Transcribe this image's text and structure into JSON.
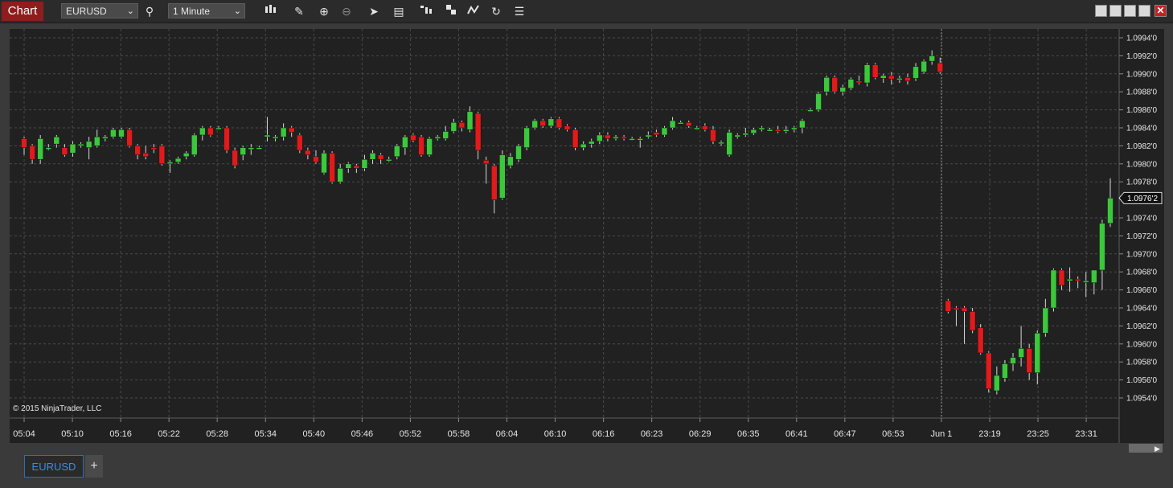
{
  "toolbar": {
    "chart_tab": "Chart",
    "instrument": "EURUSD",
    "interval": "1 Minute"
  },
  "chart": {
    "copyright": "© 2015 NinjaTrader, LLC",
    "price_labels": [
      "1.0994'0",
      "1.0992'0",
      "1.0990'0",
      "1.0988'0",
      "1.0986'0",
      "1.0984'0",
      "1.0982'0",
      "1.0980'0",
      "1.0978'0",
      "1.0976'2",
      "1.0974'0",
      "1.0972'0",
      "1.0970'0",
      "1.0968'0",
      "1.0966'0",
      "1.0964'0",
      "1.0962'0",
      "1.0960'0",
      "1.0958'0",
      "1.0956'0",
      "1.0954'0"
    ],
    "time_labels": [
      "05:04",
      "05:10",
      "05:16",
      "05:22",
      "05:28",
      "05:34",
      "05:40",
      "05:46",
      "05:52",
      "05:58",
      "06:04",
      "06:10",
      "06:16",
      "06:23",
      "06:29",
      "06:35",
      "06:41",
      "06:47",
      "06:53",
      "Jun 1",
      "23:19",
      "23:25",
      "23:31"
    ],
    "current_price": "1.0976'2",
    "colors": {
      "up": "#3cc83c",
      "down": "#e01b1b",
      "background": "#212121",
      "grid": "#4a4a4a"
    }
  },
  "chart_data": {
    "type": "candlestick",
    "instrument": "EURUSD",
    "interval": "1 Minute",
    "ylim": [
      1.0953,
      1.0995
    ],
    "candles": [
      {
        "o": 1.09828,
        "h": 1.0983,
        "l": 1.0981,
        "c": 1.09818
      },
      {
        "o": 1.0982,
        "h": 1.09822,
        "l": 1.098,
        "c": 1.09805
      },
      {
        "o": 1.09805,
        "h": 1.09832,
        "l": 1.098,
        "c": 1.09828
      },
      {
        "o": 1.09818,
        "h": 1.09822,
        "l": 1.09815,
        "c": 1.09818
      },
      {
        "o": 1.09822,
        "h": 1.09832,
        "l": 1.09818,
        "c": 1.0983
      },
      {
        "o": 1.09818,
        "h": 1.09822,
        "l": 1.09808,
        "c": 1.0981
      },
      {
        "o": 1.09812,
        "h": 1.09825,
        "l": 1.09808,
        "c": 1.09822
      },
      {
        "o": 1.09822,
        "h": 1.09824,
        "l": 1.09818,
        "c": 1.09822
      },
      {
        "o": 1.09818,
        "h": 1.0983,
        "l": 1.09805,
        "c": 1.09825
      },
      {
        "o": 1.0982,
        "h": 1.09838,
        "l": 1.09818,
        "c": 1.0983
      },
      {
        "o": 1.09828,
        "h": 1.09832,
        "l": 1.09825,
        "c": 1.0983
      },
      {
        "o": 1.0983,
        "h": 1.0984,
        "l": 1.09828,
        "c": 1.09838
      },
      {
        "o": 1.0983,
        "h": 1.0984,
        "l": 1.09828,
        "c": 1.09838
      },
      {
        "o": 1.09838,
        "h": 1.0984,
        "l": 1.09818,
        "c": 1.0982
      },
      {
        "o": 1.0982,
        "h": 1.09822,
        "l": 1.09805,
        "c": 1.0981
      },
      {
        "o": 1.09812,
        "h": 1.0982,
        "l": 1.09805,
        "c": 1.09808
      },
      {
        "o": 1.09818,
        "h": 1.09822,
        "l": 1.09812,
        "c": 1.09816
      },
      {
        "o": 1.0982,
        "h": 1.09822,
        "l": 1.09798,
        "c": 1.098
      },
      {
        "o": 1.098,
        "h": 1.09804,
        "l": 1.0979,
        "c": 1.09802
      },
      {
        "o": 1.09802,
        "h": 1.09808,
        "l": 1.098,
        "c": 1.09806
      },
      {
        "o": 1.09808,
        "h": 1.09814,
        "l": 1.09805,
        "c": 1.09812
      },
      {
        "o": 1.0981,
        "h": 1.09834,
        "l": 1.09808,
        "c": 1.09832
      },
      {
        "o": 1.09832,
        "h": 1.09842,
        "l": 1.09826,
        "c": 1.0984
      },
      {
        "o": 1.0984,
        "h": 1.09842,
        "l": 1.0983,
        "c": 1.09832
      },
      {
        "o": 1.0984,
        "h": 1.09842,
        "l": 1.09838,
        "c": 1.0984
      },
      {
        "o": 1.0984,
        "h": 1.09842,
        "l": 1.09812,
        "c": 1.09815
      },
      {
        "o": 1.09815,
        "h": 1.09818,
        "l": 1.09795,
        "c": 1.09798
      },
      {
        "o": 1.0981,
        "h": 1.0982,
        "l": 1.09804,
        "c": 1.09818
      },
      {
        "o": 1.09816,
        "h": 1.09822,
        "l": 1.0981,
        "c": 1.09818
      },
      {
        "o": 1.09818,
        "h": 1.0982,
        "l": 1.09816,
        "c": 1.09818
      },
      {
        "o": 1.0983,
        "h": 1.09852,
        "l": 1.09825,
        "c": 1.09832
      },
      {
        "o": 1.0983,
        "h": 1.09832,
        "l": 1.09825,
        "c": 1.0983
      },
      {
        "o": 1.0983,
        "h": 1.09845,
        "l": 1.09826,
        "c": 1.0984
      },
      {
        "o": 1.0984,
        "h": 1.09842,
        "l": 1.0983,
        "c": 1.09835
      },
      {
        "o": 1.09832,
        "h": 1.09834,
        "l": 1.09812,
        "c": 1.09815
      },
      {
        "o": 1.09815,
        "h": 1.09818,
        "l": 1.09805,
        "c": 1.0981
      },
      {
        "o": 1.09808,
        "h": 1.09815,
        "l": 1.098,
        "c": 1.09802
      },
      {
        "o": 1.0979,
        "h": 1.09815,
        "l": 1.09788,
        "c": 1.09812
      },
      {
        "o": 1.09812,
        "h": 1.09814,
        "l": 1.09778,
        "c": 1.0978
      },
      {
        "o": 1.0978,
        "h": 1.098,
        "l": 1.09778,
        "c": 1.09795
      },
      {
        "o": 1.09795,
        "h": 1.09802,
        "l": 1.0979,
        "c": 1.098
      },
      {
        "o": 1.09798,
        "h": 1.098,
        "l": 1.0979,
        "c": 1.09795
      },
      {
        "o": 1.09795,
        "h": 1.0981,
        "l": 1.09792,
        "c": 1.09805
      },
      {
        "o": 1.09805,
        "h": 1.09815,
        "l": 1.098,
        "c": 1.09812
      },
      {
        "o": 1.0981,
        "h": 1.09812,
        "l": 1.098,
        "c": 1.09805
      },
      {
        "o": 1.09805,
        "h": 1.09808,
        "l": 1.09802,
        "c": 1.09805
      },
      {
        "o": 1.09808,
        "h": 1.09822,
        "l": 1.09805,
        "c": 1.0982
      },
      {
        "o": 1.09818,
        "h": 1.09832,
        "l": 1.0981,
        "c": 1.0983
      },
      {
        "o": 1.09832,
        "h": 1.09834,
        "l": 1.09824,
        "c": 1.09826
      },
      {
        "o": 1.0983,
        "h": 1.09832,
        "l": 1.09808,
        "c": 1.0981
      },
      {
        "o": 1.0981,
        "h": 1.0983,
        "l": 1.09808,
        "c": 1.09828
      },
      {
        "o": 1.09828,
        "h": 1.09832,
        "l": 1.09826,
        "c": 1.0983
      },
      {
        "o": 1.09828,
        "h": 1.09842,
        "l": 1.09826,
        "c": 1.09836
      },
      {
        "o": 1.09836,
        "h": 1.0985,
        "l": 1.09834,
        "c": 1.09846
      },
      {
        "o": 1.09846,
        "h": 1.09848,
        "l": 1.09836,
        "c": 1.0984
      },
      {
        "o": 1.09838,
        "h": 1.09864,
        "l": 1.09835,
        "c": 1.09858
      },
      {
        "o": 1.09856,
        "h": 1.09858,
        "l": 1.09805,
        "c": 1.09815
      },
      {
        "o": 1.09804,
        "h": 1.09808,
        "l": 1.09778,
        "c": 1.098
      },
      {
        "o": 1.09798,
        "h": 1.098,
        "l": 1.09745,
        "c": 1.0976
      },
      {
        "o": 1.09762,
        "h": 1.09815,
        "l": 1.0976,
        "c": 1.0981
      },
      {
        "o": 1.09798,
        "h": 1.09812,
        "l": 1.09795,
        "c": 1.09808
      },
      {
        "o": 1.09805,
        "h": 1.09822,
        "l": 1.09802,
        "c": 1.0982
      },
      {
        "o": 1.09818,
        "h": 1.09842,
        "l": 1.09815,
        "c": 1.0984
      },
      {
        "o": 1.0984,
        "h": 1.0985,
        "l": 1.09838,
        "c": 1.09848
      },
      {
        "o": 1.09848,
        "h": 1.0985,
        "l": 1.0984,
        "c": 1.09842
      },
      {
        "o": 1.09842,
        "h": 1.09852,
        "l": 1.0984,
        "c": 1.0985
      },
      {
        "o": 1.0985,
        "h": 1.09852,
        "l": 1.09838,
        "c": 1.0984
      },
      {
        "o": 1.09842,
        "h": 1.09844,
        "l": 1.09836,
        "c": 1.09838
      },
      {
        "o": 1.09838,
        "h": 1.0984,
        "l": 1.09815,
        "c": 1.09818
      },
      {
        "o": 1.09818,
        "h": 1.09825,
        "l": 1.09815,
        "c": 1.09822
      },
      {
        "o": 1.09822,
        "h": 1.09828,
        "l": 1.09818,
        "c": 1.09825
      },
      {
        "o": 1.09825,
        "h": 1.09835,
        "l": 1.09822,
        "c": 1.09832
      },
      {
        "o": 1.09832,
        "h": 1.09835,
        "l": 1.09825,
        "c": 1.09828
      },
      {
        "o": 1.09828,
        "h": 1.09832,
        "l": 1.09826,
        "c": 1.0983
      },
      {
        "o": 1.0983,
        "h": 1.09832,
        "l": 1.09826,
        "c": 1.09828
      },
      {
        "o": 1.09828,
        "h": 1.0983,
        "l": 1.09826,
        "c": 1.09828
      },
      {
        "o": 1.09828,
        "h": 1.0983,
        "l": 1.09818,
        "c": 1.09828
      },
      {
        "o": 1.0983,
        "h": 1.09836,
        "l": 1.09828,
        "c": 1.09832
      },
      {
        "o": 1.09835,
        "h": 1.09838,
        "l": 1.0983,
        "c": 1.09832
      },
      {
        "o": 1.09832,
        "h": 1.09842,
        "l": 1.0983,
        "c": 1.0984
      },
      {
        "o": 1.0984,
        "h": 1.09852,
        "l": 1.09838,
        "c": 1.09848
      },
      {
        "o": 1.09846,
        "h": 1.09848,
        "l": 1.09844,
        "c": 1.09846
      },
      {
        "o": 1.09846,
        "h": 1.09848,
        "l": 1.0984,
        "c": 1.09842
      },
      {
        "o": 1.0984,
        "h": 1.09842,
        "l": 1.09838,
        "c": 1.0984
      },
      {
        "o": 1.09842,
        "h": 1.09845,
        "l": 1.09836,
        "c": 1.09838
      },
      {
        "o": 1.09838,
        "h": 1.09842,
        "l": 1.09822,
        "c": 1.09825
      },
      {
        "o": 1.09824,
        "h": 1.09826,
        "l": 1.0982,
        "c": 1.09824
      },
      {
        "o": 1.0981,
        "h": 1.09838,
        "l": 1.09808,
        "c": 1.09835
      },
      {
        "o": 1.0983,
        "h": 1.09834,
        "l": 1.09828,
        "c": 1.09832
      },
      {
        "o": 1.09832,
        "h": 1.0984,
        "l": 1.0983,
        "c": 1.09834
      },
      {
        "o": 1.09834,
        "h": 1.0984,
        "l": 1.09832,
        "c": 1.09838
      },
      {
        "o": 1.09838,
        "h": 1.09842,
        "l": 1.09836,
        "c": 1.0984
      },
      {
        "o": 1.09838,
        "h": 1.0984,
        "l": 1.09836,
        "c": 1.09838
      },
      {
        "o": 1.09838,
        "h": 1.09842,
        "l": 1.09834,
        "c": 1.09836
      },
      {
        "o": 1.09836,
        "h": 1.09842,
        "l": 1.09834,
        "c": 1.09838
      },
      {
        "o": 1.09838,
        "h": 1.09842,
        "l": 1.09835,
        "c": 1.0984
      },
      {
        "o": 1.0984,
        "h": 1.0985,
        "l": 1.09834,
        "c": 1.09848
      },
      {
        "o": 1.0986,
        "h": 1.09862,
        "l": 1.09858,
        "c": 1.0986
      },
      {
        "o": 1.0986,
        "h": 1.0988,
        "l": 1.09858,
        "c": 1.09878
      },
      {
        "o": 1.0988,
        "h": 1.09898,
        "l": 1.09876,
        "c": 1.09896
      },
      {
        "o": 1.09896,
        "h": 1.09898,
        "l": 1.09878,
        "c": 1.0988
      },
      {
        "o": 1.0988,
        "h": 1.09888,
        "l": 1.09876,
        "c": 1.09885
      },
      {
        "o": 1.09884,
        "h": 1.09896,
        "l": 1.09882,
        "c": 1.09894
      },
      {
        "o": 1.09892,
        "h": 1.09898,
        "l": 1.09888,
        "c": 1.0989
      },
      {
        "o": 1.0989,
        "h": 1.09912,
        "l": 1.09886,
        "c": 1.0991
      },
      {
        "o": 1.0991,
        "h": 1.09912,
        "l": 1.09894,
        "c": 1.09896
      },
      {
        "o": 1.09895,
        "h": 1.099,
        "l": 1.0989,
        "c": 1.09898
      },
      {
        "o": 1.09898,
        "h": 1.09902,
        "l": 1.09888,
        "c": 1.09894
      },
      {
        "o": 1.09895,
        "h": 1.09898,
        "l": 1.0989,
        "c": 1.09895
      },
      {
        "o": 1.09896,
        "h": 1.099,
        "l": 1.09888,
        "c": 1.09892
      },
      {
        "o": 1.09895,
        "h": 1.09912,
        "l": 1.09892,
        "c": 1.09908
      },
      {
        "o": 1.09902,
        "h": 1.09916,
        "l": 1.099,
        "c": 1.09914
      },
      {
        "o": 1.09914,
        "h": 1.09926,
        "l": 1.0991,
        "c": 1.0992
      },
      {
        "o": 1.09912,
        "h": 1.09918,
        "l": 1.099,
        "c": 1.09902
      },
      {
        "o": 1.09648,
        "h": 1.0965,
        "l": 1.09634,
        "c": 1.09636
      },
      {
        "o": 1.0964,
        "h": 1.09642,
        "l": 1.0962,
        "c": 1.09638
      },
      {
        "o": 1.0964,
        "h": 1.09642,
        "l": 1.096,
        "c": 1.09636
      },
      {
        "o": 1.09636,
        "h": 1.0964,
        "l": 1.09612,
        "c": 1.09615
      },
      {
        "o": 1.09618,
        "h": 1.09622,
        "l": 1.09588,
        "c": 1.0959
      },
      {
        "o": 1.0959,
        "h": 1.09592,
        "l": 1.09546,
        "c": 1.0955
      },
      {
        "o": 1.09548,
        "h": 1.09575,
        "l": 1.09544,
        "c": 1.09565
      },
      {
        "o": 1.09562,
        "h": 1.09582,
        "l": 1.09558,
        "c": 1.09578
      },
      {
        "o": 1.09578,
        "h": 1.0959,
        "l": 1.0957,
        "c": 1.09585
      },
      {
        "o": 1.09585,
        "h": 1.0962,
        "l": 1.09575,
        "c": 1.09595
      },
      {
        "o": 1.09595,
        "h": 1.096,
        "l": 1.0956,
        "c": 1.09568
      },
      {
        "o": 1.09568,
        "h": 1.09615,
        "l": 1.09555,
        "c": 1.09612
      },
      {
        "o": 1.09612,
        "h": 1.0965,
        "l": 1.09608,
        "c": 1.0964
      },
      {
        "o": 1.0964,
        "h": 1.09684,
        "l": 1.09636,
        "c": 1.09682
      },
      {
        "o": 1.09682,
        "h": 1.09684,
        "l": 1.0966,
        "c": 1.09665
      },
      {
        "o": 1.0967,
        "h": 1.09685,
        "l": 1.09658,
        "c": 1.09672
      },
      {
        "o": 1.09672,
        "h": 1.09675,
        "l": 1.09662,
        "c": 1.0967
      },
      {
        "o": 1.0967,
        "h": 1.0968,
        "l": 1.09652,
        "c": 1.0967
      },
      {
        "o": 1.09668,
        "h": 1.09682,
        "l": 1.09655,
        "c": 1.09682
      },
      {
        "o": 1.09682,
        "h": 1.09738,
        "l": 1.0966,
        "c": 1.09734
      },
      {
        "o": 1.09734,
        "h": 1.09784,
        "l": 1.0973,
        "c": 1.09762
      }
    ]
  }
}
